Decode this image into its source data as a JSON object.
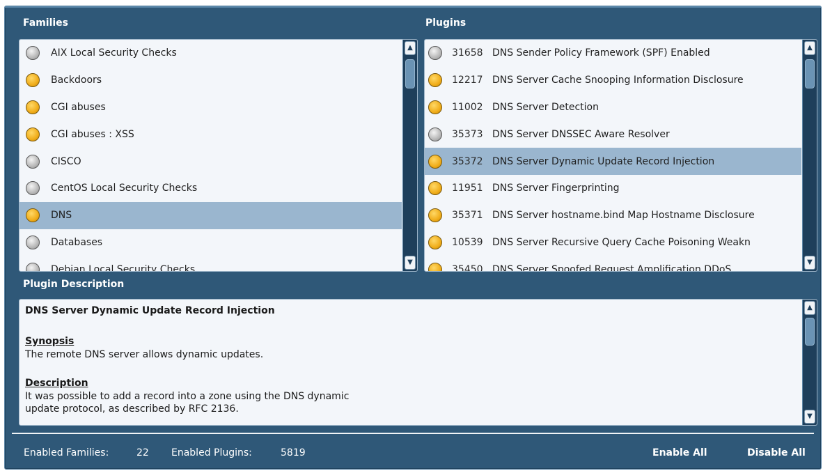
{
  "families": {
    "title": "Families",
    "items": [
      {
        "label": "AIX Local Security Checks",
        "status": "gray"
      },
      {
        "label": "Backdoors",
        "status": "orange"
      },
      {
        "label": "CGI abuses",
        "status": "orange"
      },
      {
        "label": "CGI abuses : XSS",
        "status": "orange"
      },
      {
        "label": "CISCO",
        "status": "gray"
      },
      {
        "label": "CentOS Local Security Checks",
        "status": "gray"
      },
      {
        "label": "DNS",
        "status": "orange",
        "selected": true
      },
      {
        "label": "Databases",
        "status": "gray"
      },
      {
        "label": "Debian Local Security Checks",
        "status": "gray"
      }
    ]
  },
  "plugins": {
    "title": "Plugins",
    "items": [
      {
        "id": "31658",
        "label": "DNS Sender Policy Framework (SPF) Enabled",
        "status": "gray"
      },
      {
        "id": "12217",
        "label": "DNS Server Cache Snooping Information Disclosure",
        "status": "orange"
      },
      {
        "id": "11002",
        "label": "DNS Server Detection",
        "status": "orange"
      },
      {
        "id": "35373",
        "label": "DNS Server DNSSEC Aware Resolver",
        "status": "gray"
      },
      {
        "id": "35372",
        "label": "DNS Server Dynamic Update Record Injection",
        "status": "orange",
        "selected": true
      },
      {
        "id": "11951",
        "label": "DNS Server Fingerprinting",
        "status": "orange"
      },
      {
        "id": "35371",
        "label": "DNS Server hostname.bind Map Hostname Disclosure",
        "status": "orange"
      },
      {
        "id": "10539",
        "label": "DNS Server Recursive Query Cache Poisoning Weakn",
        "status": "orange"
      },
      {
        "id": "35450",
        "label": "DNS Server Spoofed Request Amplification DDoS",
        "status": "orange"
      }
    ]
  },
  "description": {
    "title": "Plugin Description",
    "plugin_name": "DNS Server Dynamic Update Record Injection",
    "synopsis_heading": "Synopsis",
    "synopsis_text": "The remote DNS server allows dynamic updates.",
    "description_heading": "Description",
    "description_line1": "It was possible to add a record into a zone using the DNS dynamic",
    "description_line2": "update protocol, as described by RFC 2136."
  },
  "footer": {
    "families_label": "Enabled Families:",
    "families_count": "22",
    "plugins_label": "Enabled Plugins:",
    "plugins_count": "5819",
    "enable_all": "Enable All",
    "disable_all": "Disable All"
  },
  "scroll": {
    "up_glyph": "▲",
    "down_glyph": "▼"
  },
  "colors": {
    "frame_bg": "#2f5878",
    "list_bg": "#f3f6fa",
    "selected_row": "#9ab6cf",
    "status_orange": "#f0ad1a",
    "status_gray": "#b8b8b8"
  }
}
